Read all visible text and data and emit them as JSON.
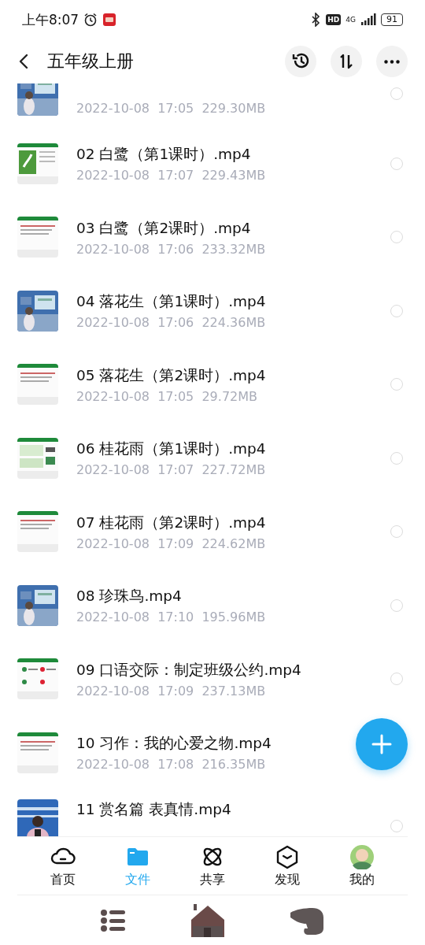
{
  "status_bar": {
    "time": "上午8:07",
    "hd": "HD",
    "network": "4G",
    "battery": "91"
  },
  "header": {
    "title": "五年级上册"
  },
  "files": [
    {
      "kind": "partial",
      "meta": "2022-10-08  17:05  229.30MB",
      "selected": false
    },
    {
      "kind": "full",
      "name": "02 白鹭（第1课时）.mp4",
      "meta": "2022-10-08  17:07  229.43MB",
      "selected": false
    },
    {
      "kind": "full",
      "name": "03 白鹭（第2课时）.mp4",
      "meta": "2022-10-08  17:06  233.32MB",
      "selected": false
    },
    {
      "kind": "full",
      "name": "04 落花生（第1课时）.mp4",
      "meta": "2022-10-08  17:06  224.36MB",
      "selected": false
    },
    {
      "kind": "full",
      "name": "05 落花生（第2课时）.mp4",
      "meta": "2022-10-08  17:05  29.72MB",
      "selected": false
    },
    {
      "kind": "full",
      "name": "06 桂花雨（第1课时）.mp4",
      "meta": "2022-10-08  17:07  227.72MB",
      "selected": false
    },
    {
      "kind": "full",
      "name": "07 桂花雨（第2课时）.mp4",
      "meta": "2022-10-08  17:09  224.62MB",
      "selected": false
    },
    {
      "kind": "full",
      "name": "08 珍珠鸟.mp4",
      "meta": "2022-10-08  17:10  195.96MB",
      "selected": false
    },
    {
      "kind": "full",
      "name": "09 口语交际：制定班级公约.mp4",
      "meta": "2022-10-08  17:09  237.13MB",
      "selected": false
    },
    {
      "kind": "full",
      "name": "10 习作：我的心爱之物.mp4",
      "meta": "2022-10-08  17:08  216.35MB"
    },
    {
      "kind": "cut",
      "name": "11 赏名篇 表真情.mp4",
      "selected": false
    }
  ],
  "tabs": [
    {
      "label": "首页",
      "selected": false
    },
    {
      "label": "文件",
      "selected": true
    },
    {
      "label": "共享",
      "selected": false
    },
    {
      "label": "发现",
      "selected": false
    },
    {
      "label": "我的",
      "selected": false
    }
  ]
}
